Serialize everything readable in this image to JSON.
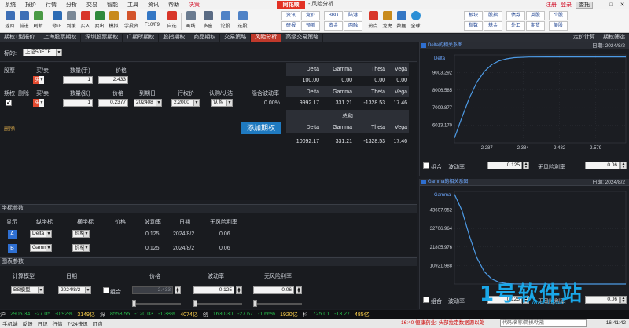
{
  "menu": {
    "items": [
      "系统",
      "报价",
      "行情",
      "分析",
      "交易",
      "智能",
      "工具",
      "资讯",
      "帮助",
      "决策"
    ],
    "logo": "同花顺",
    "window_title": "- 风险分析",
    "register": "注册",
    "login": "登录",
    "user": "委托"
  },
  "toolbar": {
    "buttons": [
      "返回",
      "前进",
      "刷新",
      "修正",
      "到缓",
      "买入",
      "卖出",
      "模拟",
      "学投资",
      "F10/F9",
      "自选",
      "F10/F9",
      "画线",
      "多窗",
      "论股",
      "选股"
    ],
    "grid_left": [
      "资讯",
      "竞价",
      "BBD",
      "陆港",
      "研报",
      "预测",
      "资金",
      "两融"
    ],
    "buttons_mid": [
      "热点",
      "龙虎",
      "数据",
      "全球"
    ],
    "grid_right": [
      "板块",
      "股指",
      "债券",
      "英股",
      "个股",
      "指数",
      "基金",
      "外汇",
      "期货",
      "美股"
    ]
  },
  "tabs": {
    "items": [
      "期权T型报价",
      "上海股票期权",
      "深圳股票期权",
      "广期所期权",
      "股指期权",
      "商品期权",
      "交易策略",
      "风险分析",
      "高级交易策略"
    ],
    "active": "风险分析",
    "right": [
      "定价计算",
      "期权筛选"
    ]
  },
  "subject": {
    "label": "标的:",
    "value": "上证50ETF"
  },
  "stock_row": {
    "headers": [
      "股票",
      "买/卖",
      "数量(手)",
      "价格"
    ],
    "side": "买",
    "qty": "1",
    "price": "2.433"
  },
  "option_row": {
    "headers": [
      "期权",
      "删除",
      "买/卖",
      "数量(张)",
      "价格",
      "到期日",
      "行权价",
      "认购/认沽",
      "隐含波动率"
    ],
    "checked": "✔",
    "side": "买",
    "qty": "1",
    "price": "0.2377",
    "expiry": "202408",
    "strike": "2.2000",
    "type": "认购",
    "iv": "0.00%"
  },
  "delete_label": "删除",
  "add_option_label": "添加期权",
  "greeks": {
    "headers": [
      "Delta",
      "Gamma",
      "Theta",
      "Vega"
    ],
    "stock": [
      "100.00",
      "0.00",
      "0.00",
      "0.00"
    ],
    "option": [
      "9992.17",
      "331.21",
      "-1328.53",
      "17.46"
    ],
    "total_label": "总和",
    "total": [
      "10092.17",
      "331.21",
      "-1328.53",
      "17.46"
    ]
  },
  "coord_params": {
    "title": "坐标参数",
    "headers": [
      "显示",
      "纵坐标",
      "横坐标",
      "价格",
      "波动率",
      "日期",
      "无风险利率"
    ],
    "rows": [
      {
        "id": "A",
        "y": "Delta",
        "x": "价格",
        "vol": "0.125",
        "date": "2024/8/2",
        "rate": "0.06"
      },
      {
        "id": "B",
        "y": "Gamma",
        "x": "价格",
        "vol": "0.125",
        "date": "2024/8/2",
        "rate": "0.06"
      }
    ]
  },
  "chart_params": {
    "title": "图表参数",
    "headers": [
      "计算模型",
      "日期",
      "价格",
      "波动率",
      "无风险利率"
    ],
    "model": "BS模型",
    "date": "2024/8/2",
    "combo_label": "组合",
    "price": "2.433",
    "vol": "0.125",
    "rate": "0.06"
  },
  "chart_delta": {
    "title": "Delta的相关系图",
    "date": "日期: 2024/8/2",
    "series_label": "Delta",
    "footer": {
      "combo": "组合",
      "vol_label": "波动率",
      "vol": "0.125",
      "rate_label": "无风险利率",
      "rate": "0.06"
    }
  },
  "chart_gamma": {
    "title": "Gamma的相关系图",
    "date": "日期: 2024/8/2",
    "series_label": "Gamma",
    "footer": {
      "combo": "组合",
      "vol_label": "波动率",
      "vol": "0.125",
      "rate_label": "无风险利率",
      "rate": "0.06"
    }
  },
  "chart_data": [
    {
      "type": "line",
      "title": "Delta的相关系图",
      "series_name": "Delta",
      "y_ticks": [
        "9003.292",
        "8006.585",
        "7009.877",
        "6013.170"
      ],
      "x_ticks": [
        "2.287",
        "2.384",
        "2.482",
        "2.579"
      ],
      "ylim": [
        5600,
        10100
      ],
      "xlim": [
        2.2,
        2.66
      ],
      "x": [
        2.2,
        2.22,
        2.24,
        2.26,
        2.28,
        2.3,
        2.32,
        2.34,
        2.36,
        2.4,
        2.45,
        2.5,
        2.66
      ],
      "y": [
        5850,
        6900,
        7900,
        8700,
        9250,
        9600,
        9800,
        9900,
        9960,
        9990,
        9995,
        9996,
        9996
      ]
    },
    {
      "type": "line",
      "title": "Gamma的相关系图",
      "series_name": "Gamma",
      "y_ticks": [
        "43607.952",
        "32706.964",
        "21805.976",
        "10921.988"
      ],
      "x_ticks": [],
      "ylim": [
        0,
        49000
      ],
      "xlim": [
        2.2,
        2.66
      ],
      "x": [
        2.2,
        2.22,
        2.24,
        2.26,
        2.28,
        2.3,
        2.32,
        2.34,
        2.36,
        2.4,
        2.45,
        2.5,
        2.66
      ],
      "y": [
        47500,
        39000,
        25500,
        14000,
        6600,
        2700,
        900,
        300,
        100,
        20,
        5,
        0,
        0
      ]
    }
  ],
  "ticker": [
    {
      "label": "沪",
      "color": "#d6d6d6"
    },
    {
      "label": "2905.34",
      "color": "#27c24c"
    },
    {
      "label": "-27.05",
      "color": "#27c24c"
    },
    {
      "label": "-0.92%",
      "color": "#27c24c"
    },
    {
      "label": "3149亿",
      "color": "#ffd34d"
    },
    {
      "label": "深",
      "color": "#d6d6d6"
    },
    {
      "label": "8553.55",
      "color": "#27c24c"
    },
    {
      "label": "-120.03",
      "color": "#27c24c"
    },
    {
      "label": "-1.38%",
      "color": "#27c24c"
    },
    {
      "label": "4074亿",
      "color": "#ffd34d"
    },
    {
      "label": "创",
      "color": "#d6d6d6"
    },
    {
      "label": "1630.30",
      "color": "#27c24c"
    },
    {
      "label": "-27.67",
      "color": "#27c24c"
    },
    {
      "label": "-1.66%",
      "color": "#27c24c"
    },
    {
      "label": "1920亿",
      "color": "#ffd34d"
    },
    {
      "label": "科",
      "color": "#d6d6d6"
    },
    {
      "label": "725.01",
      "color": "#27c24c"
    },
    {
      "label": "-13.27",
      "color": "#27c24c"
    },
    {
      "label": "485亿",
      "color": "#ffd34d"
    }
  ],
  "bottombar": {
    "items": [
      "手机端",
      "反馈",
      "日记",
      "行情",
      "7*24快讯",
      "盯盘"
    ],
    "news": "16:40 恒康药业: 头部拉定数据源以处",
    "search": "代码/名称/简拼/功能",
    "clock": "16:41:42"
  },
  "watermark": {
    "main": "1号软件站",
    "sub": "www.1hrj.com"
  },
  "colors": {
    "accent_red": "#c0392b",
    "blue_btn": "#1f7ac0",
    "up": "#e24a2f",
    "down": "#27c24c",
    "curve": "#4d9be6"
  }
}
